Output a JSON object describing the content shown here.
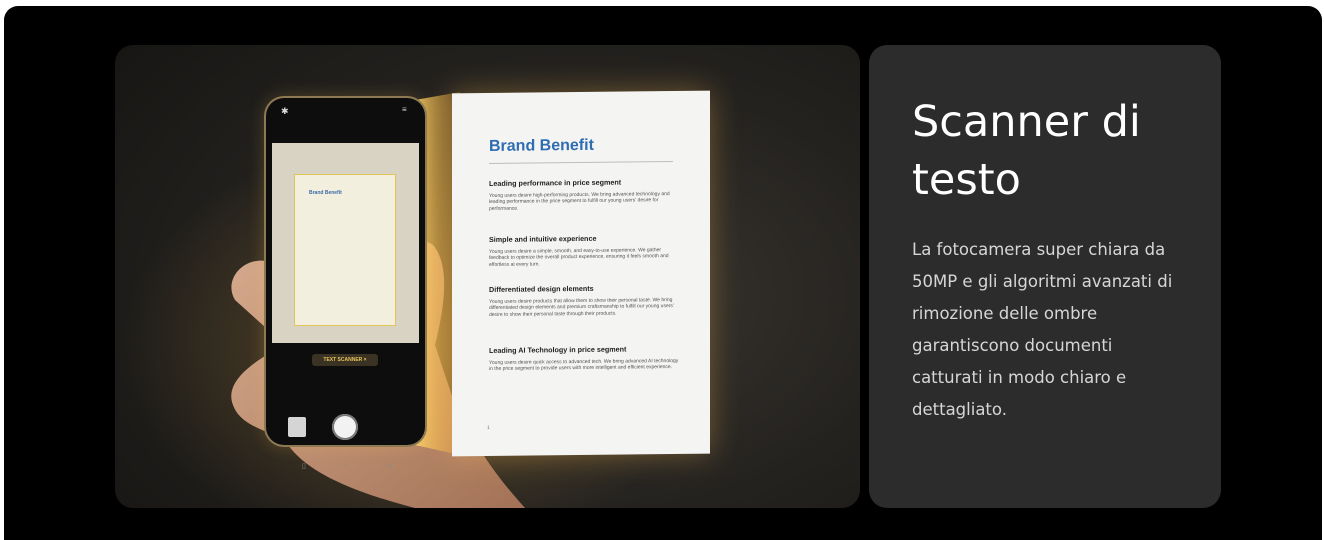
{
  "feature": {
    "title": "Scanner di testo",
    "description": "La fotocamera super chiara da 50MP e gli algoritmi avanzati di rimozione delle ombre garantiscono documenti catturati in modo chiaro e dettagliato."
  },
  "image": {
    "document": {
      "heading": "Brand Benefit",
      "sections": [
        {
          "heading": "Leading performance in price segment",
          "text": "Young users desire high-performing products. We bring advanced technology and leading performance in the price segment to fulfill our young users' desire for performance."
        },
        {
          "heading": "Simple and intuitive experience",
          "text": "Young users desire a simple, smooth, and easy-to-use experience. We gather feedback to optimize the overall product experience, ensuring it feels smooth and effortless at every turn."
        },
        {
          "heading": "Differentiated design elements",
          "text": "Young users desire products that allow them to show their personal taste. We bring differentiated design elements and premium craftsmanship to fulfill our young users' desire to show their personal taste through their products."
        },
        {
          "heading": "Leading AI Technology in price segment",
          "text": "Young users desire quick access to advanced tech. We bring advanced AI technology in the price segment to provide users with more intelligent and efficient experience."
        }
      ],
      "page_number": "1"
    },
    "phone": {
      "mini_heading": "Brand Benefit",
      "mode_chip": "TEXT SCANNER ×",
      "icons": [
        "flash-icon",
        "menu-icon",
        "gallery-thumbnail",
        "shutter-button",
        "nav-back-icon",
        "nav-home-icon",
        "nav-recent-icon"
      ]
    }
  },
  "colors": {
    "page_bg": "#000000",
    "card_bg": "#2c2c2c",
    "title": "#ffffff",
    "body_text": "#d6d6d6",
    "doc_heading": "#2f6db3",
    "scan_highlight": "#e2c55a"
  }
}
